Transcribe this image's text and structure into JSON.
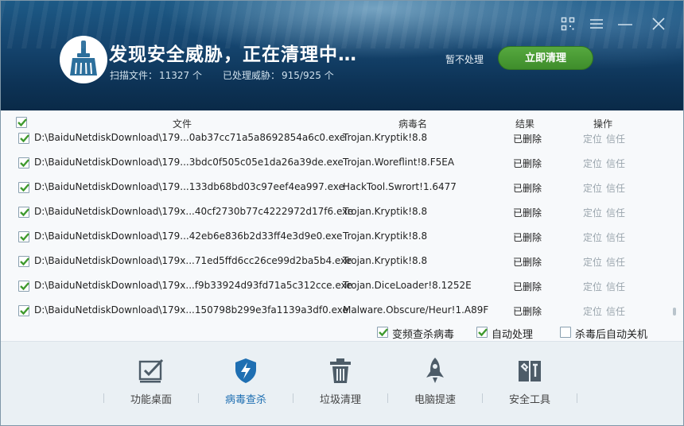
{
  "header": {
    "title": "发现安全威胁，正在清理中…",
    "scanned_label": "扫描文件：",
    "scanned_value": "11327 个",
    "processed_label": "已处理威胁：",
    "processed_value": "915/925 个",
    "skip_label": "暂不处理",
    "clean_label": "立即清理"
  },
  "window_controls": [
    "qr-code-icon",
    "menu-icon",
    "minimize-icon",
    "close-icon"
  ],
  "table": {
    "columns": {
      "file": "文件",
      "virus": "病毒名",
      "result": "结果",
      "action": "操作"
    },
    "rows": [
      {
        "file": "D:\\BaiduNetdiskDownload\\179...0ab37cc71a5a8692854a6c0.exe",
        "virus": "Trojan.Kryptik!8.8",
        "result": "已删除",
        "locate": "定位",
        "trust": "信任"
      },
      {
        "file": "D:\\BaiduNetdiskDownload\\179...3bdc0f505c05e1da26a39de.exe",
        "virus": "Trojan.Woreflint!8.F5EA",
        "result": "已删除",
        "locate": "定位",
        "trust": "信任"
      },
      {
        "file": "D:\\BaiduNetdiskDownload\\179...133db68bd03c97eef4ea997.exe",
        "virus": "HackTool.Swrort!1.6477",
        "result": "已删除",
        "locate": "定位",
        "trust": "信任"
      },
      {
        "file": "D:\\BaiduNetdiskDownload\\179x...40cf2730b77c4222972d17f6.exe",
        "virus": "Trojan.Kryptik!8.8",
        "result": "已删除",
        "locate": "定位",
        "trust": "信任"
      },
      {
        "file": "D:\\BaiduNetdiskDownload\\179...42eb6e836b2d33ff4e3d9e0.exe",
        "virus": "Trojan.Kryptik!8.8",
        "result": "已删除",
        "locate": "定位",
        "trust": "信任"
      },
      {
        "file": "D:\\BaiduNetdiskDownload\\179x...71ed5ffd6cc26ce99d2ba5b4.exe",
        "virus": "Trojan.Kryptik!8.8",
        "result": "已删除",
        "locate": "定位",
        "trust": "信任"
      },
      {
        "file": "D:\\BaiduNetdiskDownload\\179x...f9b33924d93fd71a5c312cce.exe",
        "virus": "Trojan.DiceLoader!8.1252E",
        "result": "已删除",
        "locate": "定位",
        "trust": "信任"
      },
      {
        "file": "D:\\BaiduNetdiskDownload\\179x...150798b299e3fa1139a3df0.exe",
        "virus": "Malware.Obscure/Heur!1.A89F",
        "result": "已删除",
        "locate": "定位",
        "trust": "信任"
      }
    ]
  },
  "options": [
    {
      "label": "变频查杀病毒",
      "checked": true
    },
    {
      "label": "自动处理",
      "checked": true
    },
    {
      "label": "杀毒后自动关机",
      "checked": false
    }
  ],
  "nav": [
    {
      "label": "功能桌面",
      "icon": "checkbox-board-icon",
      "active": false
    },
    {
      "label": "病毒查杀",
      "icon": "shield-lightning-icon",
      "active": true
    },
    {
      "label": "垃圾清理",
      "icon": "trash-bin-icon",
      "active": false
    },
    {
      "label": "电脑提速",
      "icon": "rocket-icon",
      "active": false
    },
    {
      "label": "安全工具",
      "icon": "toolbox-icon",
      "active": false
    }
  ],
  "colors": {
    "accent_green": "#4a9b35",
    "active_nav": "#1f6fb2",
    "header_bg": "#15456f"
  }
}
